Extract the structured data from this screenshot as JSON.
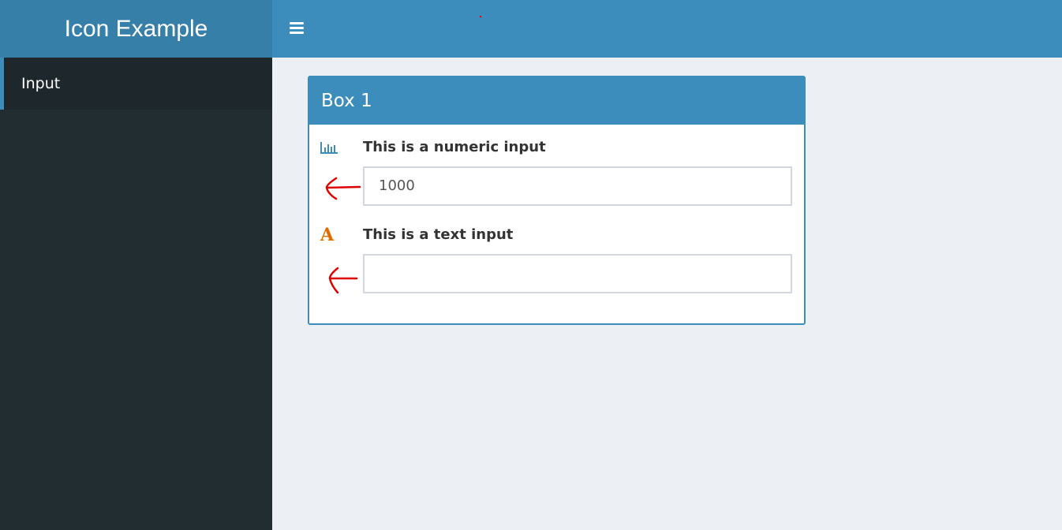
{
  "header": {
    "app_title": "Icon Example",
    "toggle_icon": "bars-icon"
  },
  "sidebar": {
    "items": [
      {
        "label": "Input",
        "active": true
      }
    ]
  },
  "box": {
    "title": "Box 1",
    "fields": [
      {
        "icon": "bar-chart-icon",
        "label": "This is a numeric input",
        "value": "1000"
      },
      {
        "icon": "font-icon",
        "icon_glyph": "A",
        "label": "This is a text input",
        "value": ""
      }
    ]
  },
  "colors": {
    "primary": "#3c8dbc",
    "logo_bg": "#367fa9",
    "sidebar_bg": "#222d32",
    "sidebar_active_bg": "#1e282c",
    "content_bg": "#ecf0f5",
    "annotation": "#e00000",
    "font_icon": "#e06c00"
  }
}
